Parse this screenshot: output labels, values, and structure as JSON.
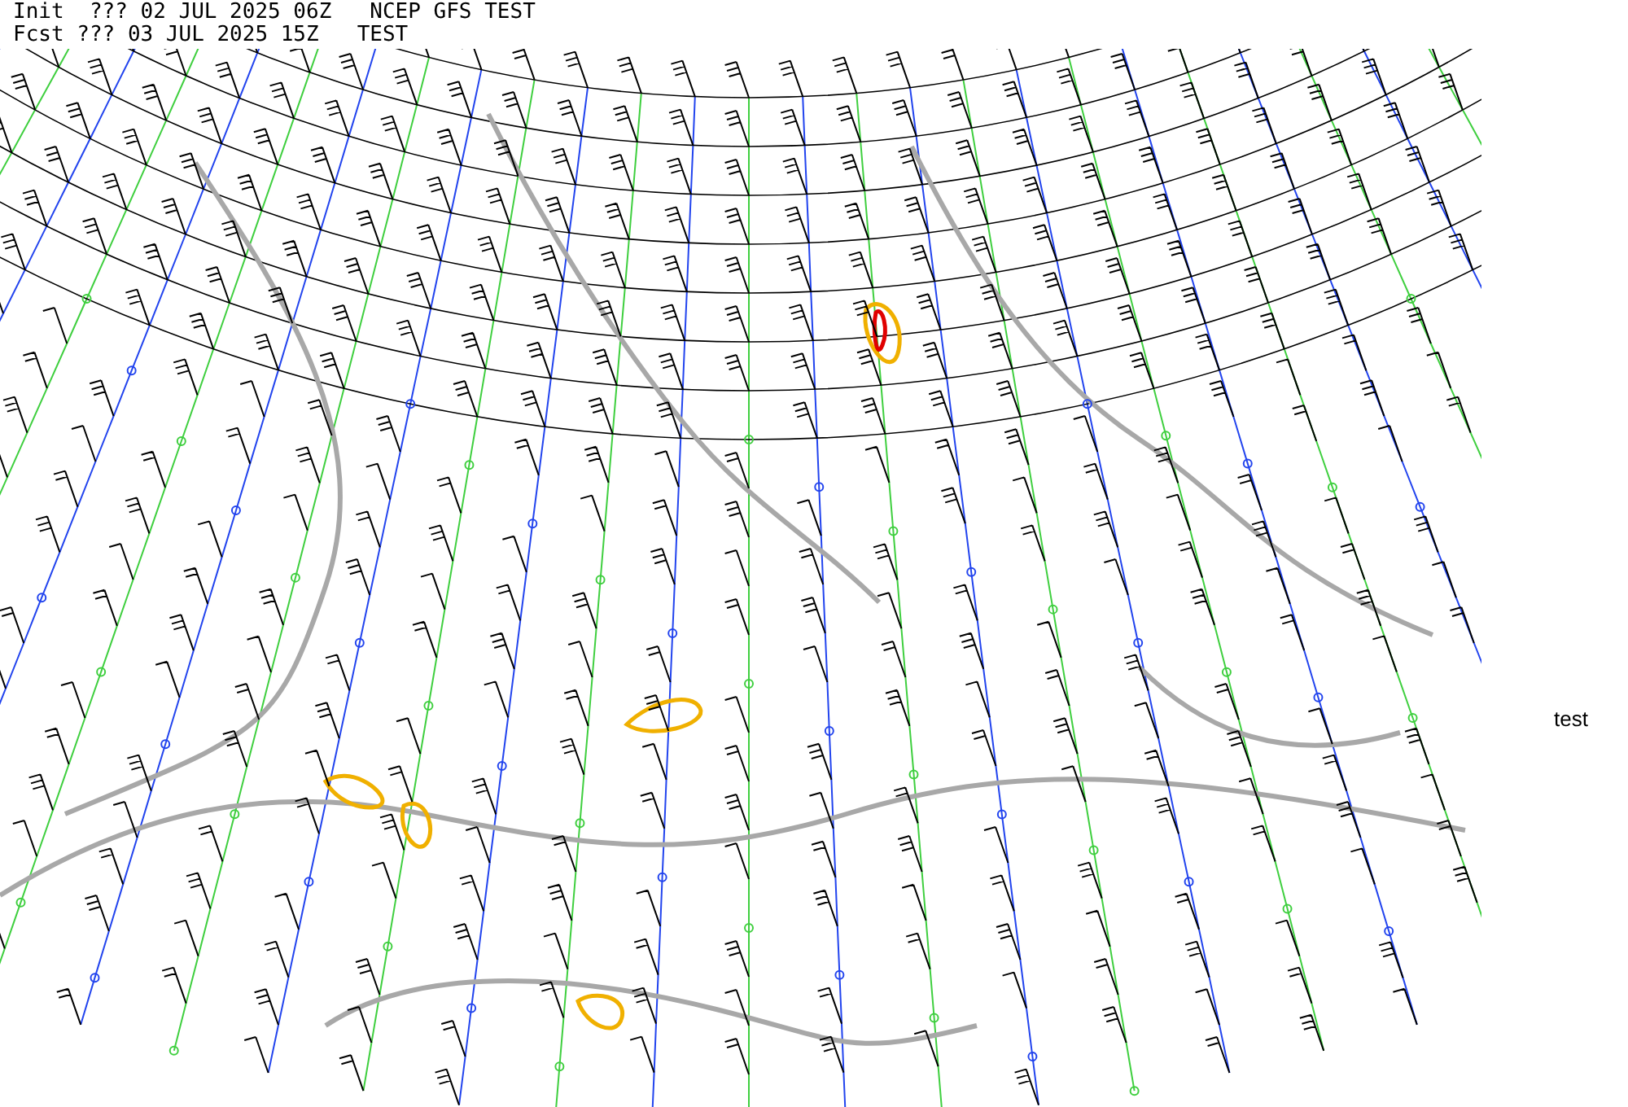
{
  "header": {
    "init_line": "Init  ??? 02 JUL 2025 06Z   NCEP GFS TEST",
    "forecast_line": "Fcst ??? 03 JUL 2025 15Z   TEST"
  },
  "side_label": "test"
}
